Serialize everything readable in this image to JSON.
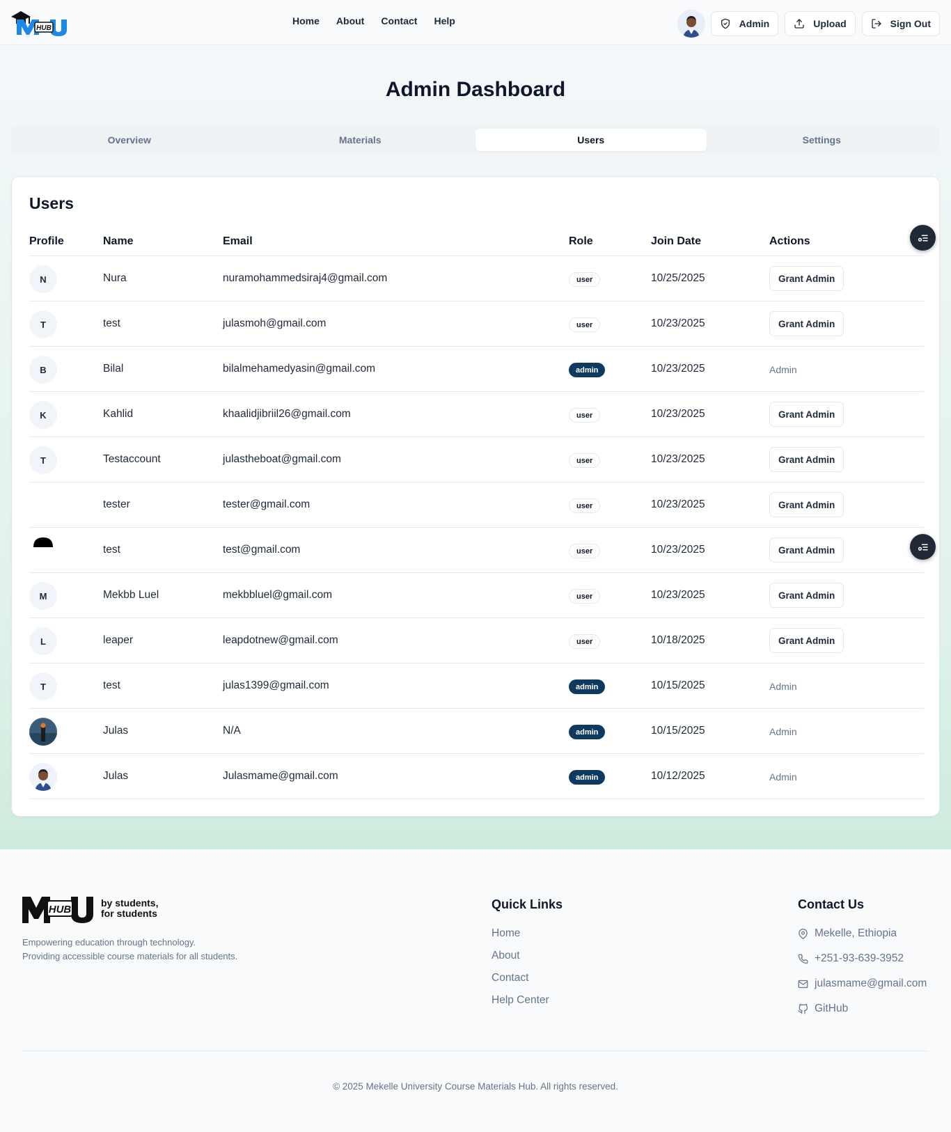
{
  "header": {
    "nav": [
      "Home",
      "About",
      "Contact",
      "Help"
    ],
    "admin_label": "Admin",
    "upload_label": "Upload",
    "signout_label": "Sign Out"
  },
  "page_title": "Admin Dashboard",
  "tabs": [
    "Overview",
    "Materials",
    "Users",
    "Settings"
  ],
  "active_tab": "Users",
  "users_card": {
    "title": "Users",
    "columns": [
      "Profile",
      "Name",
      "Email",
      "Role",
      "Join Date",
      "Actions"
    ],
    "grant_label": "Grant Admin",
    "admin_action_label": "Admin",
    "rows": [
      {
        "initial": "N",
        "name": "Nura",
        "email": "nuramohammedsiraj4@gmail.com",
        "role": "user",
        "date": "10/25/2025"
      },
      {
        "initial": "T",
        "name": "test",
        "email": "julasmoh@gmail.com",
        "role": "user",
        "date": "10/23/2025"
      },
      {
        "initial": "B",
        "name": "Bilal",
        "email": "bilalmehamedyasin@gmail.com",
        "role": "admin",
        "date": "10/23/2025"
      },
      {
        "initial": "K",
        "name": "Kahlid",
        "email": "khaalidjibriil26@gmail.com",
        "role": "user",
        "date": "10/23/2025"
      },
      {
        "initial": "T",
        "name": "Testaccount",
        "email": "julastheboat@gmail.com",
        "role": "user",
        "date": "10/23/2025"
      },
      {
        "initial": "",
        "name": "tester",
        "email": "tester@gmail.com",
        "role": "user",
        "date": "10/23/2025"
      },
      {
        "initial": "",
        "name": "test",
        "email": "test@gmail.com",
        "role": "user",
        "date": "10/23/2025"
      },
      {
        "initial": "M",
        "name": "Mekbb Luel",
        "email": "mekbbluel@gmail.com",
        "role": "user",
        "date": "10/23/2025"
      },
      {
        "initial": "L",
        "name": "leaper",
        "email": "leapdotnew@gmail.com",
        "role": "user",
        "date": "10/18/2025"
      },
      {
        "initial": "T",
        "name": "test",
        "email": "julas1399@gmail.com",
        "role": "admin",
        "date": "10/15/2025"
      },
      {
        "initial": "",
        "name": "Julas",
        "email": "N/A",
        "role": "admin",
        "date": "10/15/2025"
      },
      {
        "initial": "",
        "name": "Julas",
        "email": "Julasmame@gmail.com",
        "role": "admin",
        "date": "10/12/2025"
      }
    ]
  },
  "footer": {
    "description_line1": "Empowering education through technology.",
    "description_line2": "Providing accessible course materials for all students.",
    "logo_tagline_1": "by students,",
    "logo_tagline_2": "for students",
    "quick_links_title": "Quick Links",
    "quick_links": [
      "Home",
      "About",
      "Contact",
      "Help Center"
    ],
    "contact_title": "Contact Us",
    "contact": {
      "location": "Mekelle, Ethiopia",
      "phone": "+251-93-639-3952",
      "email": "julasmame@gmail.com",
      "github": "GitHub"
    },
    "copyright": "© 2025 Mekelle University Course Materials Hub. All rights reserved."
  },
  "colors": {
    "accent": "#0f3a5f",
    "logo_blue": "#1e88e5",
    "fab": "#1f2937"
  }
}
